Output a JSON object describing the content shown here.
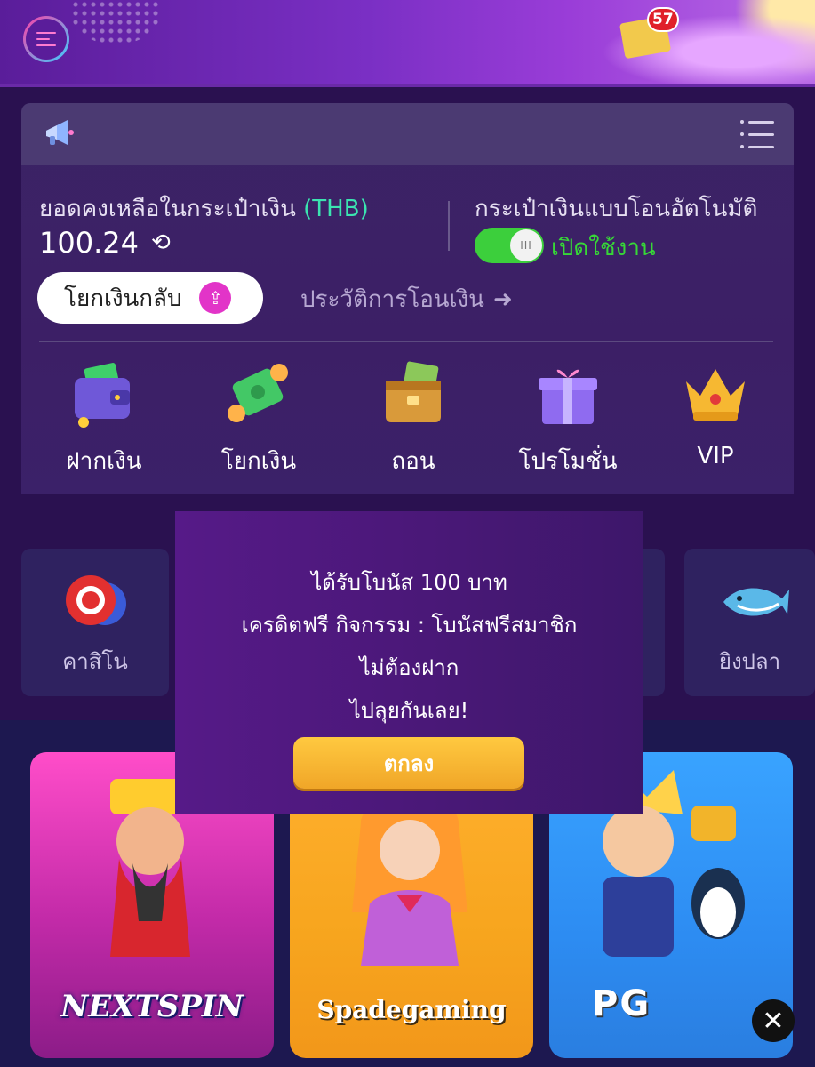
{
  "header": {
    "menu_icon": "hamburger-menu-icon",
    "notification_count": "57"
  },
  "wallet": {
    "balance_label": "ยอดคงเหลือในกระเป๋าเงิน",
    "currency": "(THB)",
    "balance": "100.24",
    "auto_wallet_label": "กระเป๋าเงินแบบโอนอัตโนมัติ",
    "auto_wallet_status": "เปิดใช้งาน",
    "auto_wallet_enabled": true,
    "withdraw_back_label": "โยกเงินกลับ",
    "history_label": "ประวัติการโอนเงิน"
  },
  "actions": [
    {
      "label": "ฝากเงิน",
      "icon": "wallet-icon"
    },
    {
      "label": "โยกเงิน",
      "icon": "money-transfer-icon"
    },
    {
      "label": "ถอน",
      "icon": "treasure-chest-icon"
    },
    {
      "label": "โปรโมชั่น",
      "icon": "gift-box-icon"
    },
    {
      "label": "VIP",
      "icon": "crown-icon"
    }
  ],
  "categories": [
    {
      "label": "คาสิโน",
      "icon": "casino-chips-icon"
    },
    {
      "label": "ยิงปลา",
      "icon": "shark-icon"
    }
  ],
  "games": [
    {
      "brand": "NEXTSPIN"
    },
    {
      "brand": "Spadegaming"
    },
    {
      "brand": "PG"
    }
  ],
  "modal": {
    "line1": "ได้รับโบนัส 100 บาท",
    "line2": "เครดิตฟรี กิจกรรม : โบนัสฟรีสมาชิก",
    "line3": "ไม่ต้องฝาก",
    "line4": "ไปลุยกันเลย!",
    "ok_label": "ตกลง"
  },
  "colors": {
    "accent_green": "#3be4b0",
    "toggle_on": "#3ccf3c",
    "ok_button": "#f5b535",
    "badge_red": "#e0202a"
  }
}
